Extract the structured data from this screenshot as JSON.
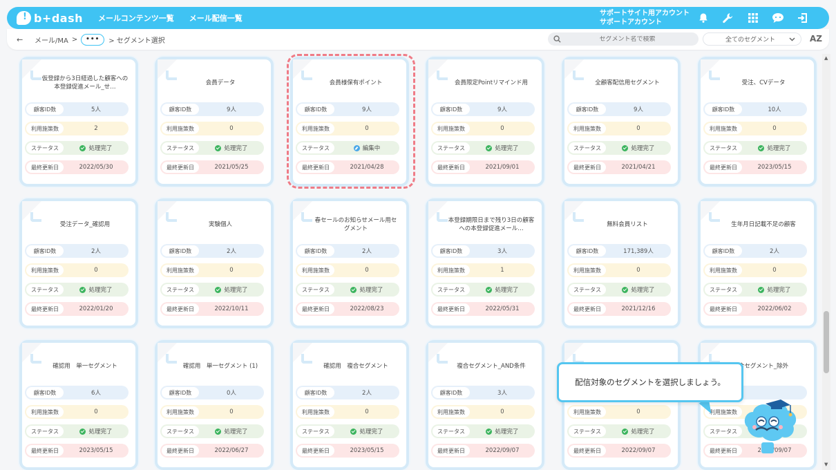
{
  "header": {
    "logo": "b+dash",
    "nav": [
      "メールコンテンツ一覧",
      "メール配信一覧"
    ],
    "account_line1": "サポートサイト用アカウント",
    "account_line2": "サポートアカウント",
    "icons": [
      "bell-icon",
      "wrench-icon",
      "grid-icon",
      "chat-icon",
      "logout-icon"
    ],
    "accent": "#3fc3f3"
  },
  "breadcrumb": {
    "back": "←",
    "first": "メール/MA",
    "sep": ">",
    "ellipsis": "•••",
    "current": "> セグメント選択"
  },
  "search": {
    "placeholder": "セグメント名で検索"
  },
  "filter": {
    "selected": "全てのセグメント",
    "arrow": "⌄"
  },
  "sort_label": "AZ",
  "labels": {
    "count": "顧客ID数",
    "usage": "利用施策数",
    "status": "ステータス",
    "updated": "最終更新日"
  },
  "cards": [
    {
      "title": "仮登録から3日経過した顧客への本登録促進メール_せ…",
      "count": "5人",
      "usage": "2",
      "status": "処理完了",
      "status_type": "done",
      "updated": "2022/05/30"
    },
    {
      "title": "会員データ",
      "count": "9人",
      "usage": "0",
      "status": "処理完了",
      "status_type": "done",
      "updated": "2021/05/25"
    },
    {
      "title": "会員様保有ポイント",
      "count": "9人",
      "usage": "0",
      "status": "編集中",
      "status_type": "edit",
      "updated": "2021/04/28"
    },
    {
      "title": "会員限定Pointリマインド用",
      "count": "9人",
      "usage": "0",
      "status": "処理完了",
      "status_type": "done",
      "updated": "2021/09/01"
    },
    {
      "title": "全顧客配信用セグメント",
      "count": "9人",
      "usage": "0",
      "status": "処理完了",
      "status_type": "done",
      "updated": "2021/04/21"
    },
    {
      "title": "受注、CVデータ",
      "count": "10人",
      "usage": "0",
      "status": "処理完了",
      "status_type": "done",
      "updated": "2023/05/15"
    },
    {
      "title": "受注データ_確認用",
      "count": "2人",
      "usage": "0",
      "status": "処理完了",
      "status_type": "done",
      "updated": "2022/01/20"
    },
    {
      "title": "実験個人",
      "count": "2人",
      "usage": "0",
      "status": "処理完了",
      "status_type": "done",
      "updated": "2022/10/11"
    },
    {
      "title": "春セールのお知らせメール用セグメント",
      "count": "2人",
      "usage": "0",
      "status": "処理完了",
      "status_type": "done",
      "updated": "2022/08/23"
    },
    {
      "title": "本登録期限日まで残り3日の顧客への本登録促進メール…",
      "count": "3人",
      "usage": "1",
      "status": "処理完了",
      "status_type": "done",
      "updated": "2022/05/31"
    },
    {
      "title": "無料会員リスト",
      "count": "171,389人",
      "usage": "0",
      "status": "処理完了",
      "status_type": "done",
      "updated": "2021/12/16"
    },
    {
      "title": "生年月日記載不足の顧客",
      "count": "2人",
      "usage": "0",
      "status": "処理完了",
      "status_type": "done",
      "updated": "2022/06/02"
    },
    {
      "title": "確認用　単一セグメント",
      "count": "6人",
      "usage": "0",
      "status": "処理完了",
      "status_type": "done",
      "updated": "2023/05/15"
    },
    {
      "title": "確認用　単一セグメント (1)",
      "count": "0人",
      "usage": "0",
      "status": "処理完了",
      "status_type": "done",
      "updated": "2022/06/27"
    },
    {
      "title": "確認用　複合セグメント",
      "count": "2人",
      "usage": "0",
      "status": "処理完了",
      "status_type": "done",
      "updated": "2023/05/15"
    },
    {
      "title": "複合セグメント_AND条件",
      "count": "3人",
      "usage": "0",
      "status": "処理完了",
      "status_type": "done",
      "updated": "2022/09/07"
    },
    {
      "title": "",
      "count": "",
      "usage": "0",
      "status": "処理完了",
      "status_type": "done",
      "updated": "2022/09/07"
    },
    {
      "title": "合セグメント_除外",
      "count": "",
      "usage": "",
      "status": "",
      "status_type": "none",
      "updated": "2022/09/07"
    }
  ],
  "tooltip": {
    "text": "配信対象のセグメントを選択しましょう。"
  },
  "mascot": "mascot-icon"
}
